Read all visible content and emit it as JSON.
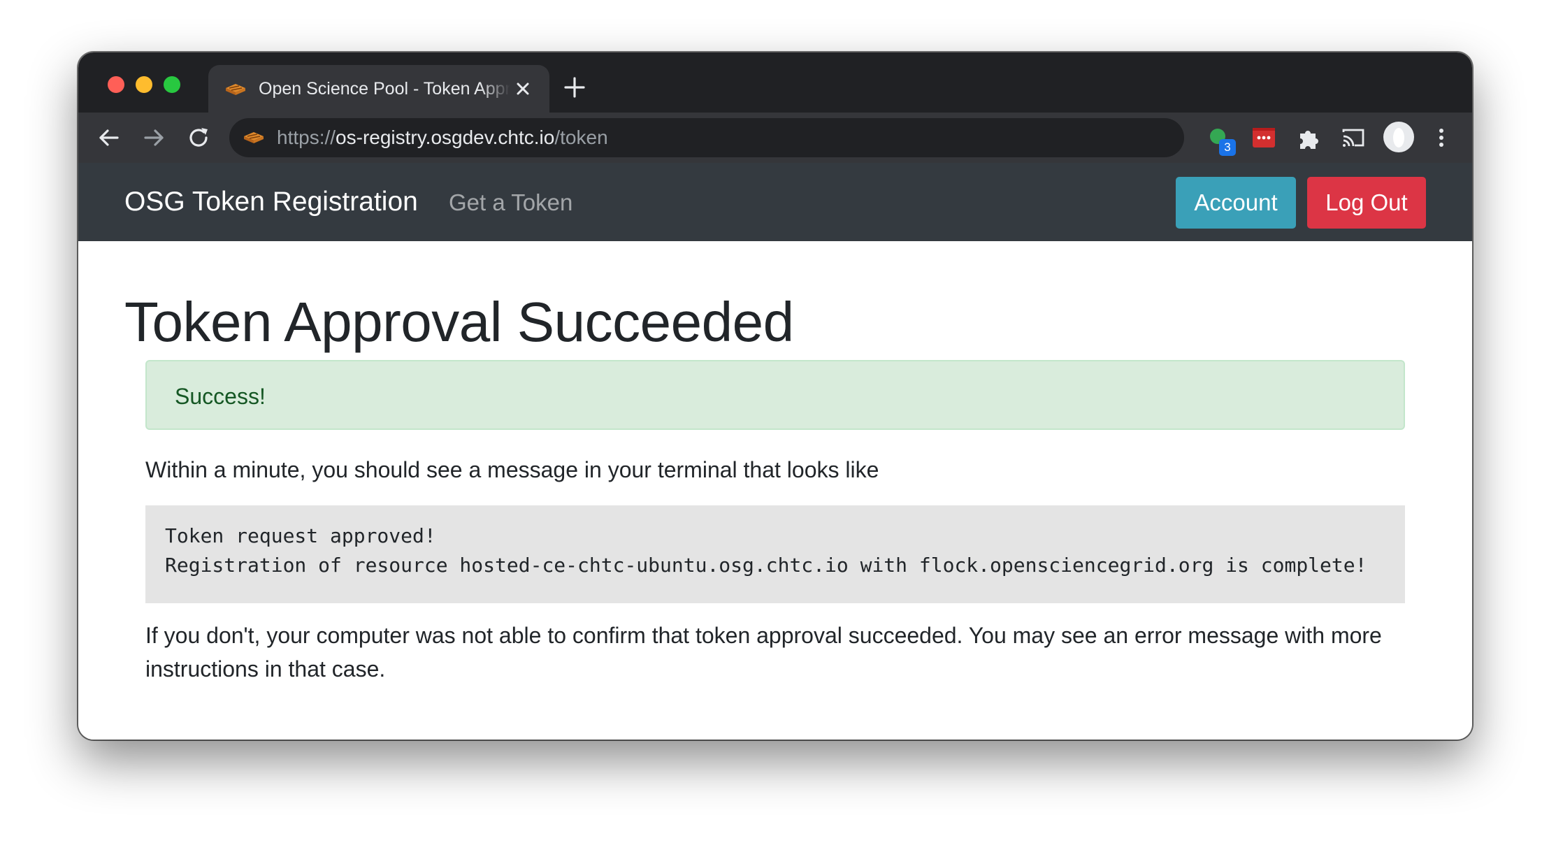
{
  "browser": {
    "tab": {
      "title": "Open Science Pool - Token Approval Succeeded"
    },
    "address_bar": {
      "scheme": "https://",
      "host": "os-registry.osgdev.chtc.io",
      "path": "/token"
    },
    "extensions": {
      "badge_count": "3"
    },
    "icons": {
      "back": "back-arrow-icon",
      "forward": "forward-arrow-icon",
      "reload": "reload-icon",
      "new_tab": "plus-icon",
      "close_tab": "close-icon",
      "menu": "kebab-menu-icon"
    }
  },
  "navbar": {
    "brand": "OSG Token Registration",
    "links": [
      {
        "label": "Get a Token"
      }
    ],
    "buttons": {
      "account": "Account",
      "logout": "Log Out"
    }
  },
  "main": {
    "title": "Token Approval Succeeded",
    "alert": "Success!",
    "intro": "Within a minute, you should see a message in your terminal that looks like",
    "code_lines": [
      "Token request approved!",
      "Registration of resource hosted-ce-chtc-ubuntu.osg.chtc.io with flock.opensciencegrid.org is complete!"
    ],
    "note": "If you don't, your computer was not able to confirm that token approval succeeded. You may see an error message with more instructions in that case."
  },
  "colors": {
    "navbar_bg": "#343a40",
    "account_button": "#3aa0b8",
    "logout_button": "#dc3545",
    "alert_bg": "#d9ecdc",
    "alert_text": "#155724",
    "code_bg": "#e4e4e4"
  }
}
